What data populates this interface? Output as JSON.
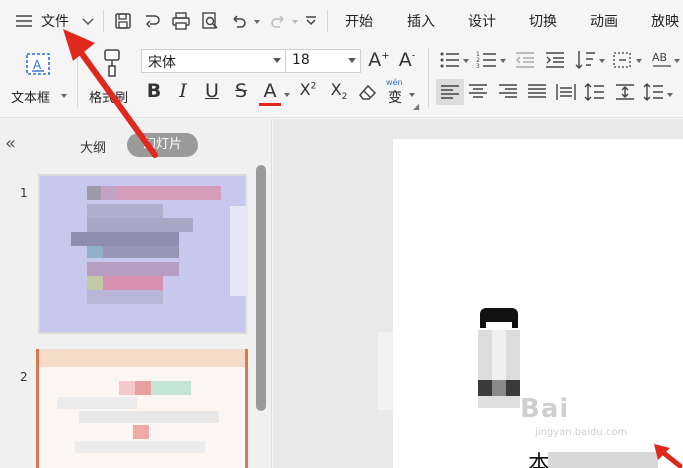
{
  "menubar": {
    "file_label": "文件",
    "tabs": [
      "开始",
      "插入",
      "设计",
      "切换",
      "动画",
      "放映"
    ]
  },
  "ribbon": {
    "textbox_label": "文本框",
    "format_painter_label": "格式刷",
    "font_name": "宋体",
    "font_size": "18",
    "phonetic_glyph": "wén",
    "phonetic_char": "变"
  },
  "left_panel": {
    "tab_outline": "大纲",
    "tab_slides": "幻灯片",
    "slide_numbers": [
      "1",
      "2"
    ]
  },
  "slide": {
    "visible_text": "本",
    "watermark": "Bai",
    "watermark_sub": "jingyan.baidu.com"
  },
  "colors": {
    "accent_red": "#e0281c",
    "font_color_underline": "#e0281c",
    "thumb_selected_border": "#d77a4f"
  },
  "icons": [
    "hamburger-icon",
    "chevron-down-icon",
    "save-icon",
    "export-icon",
    "print-icon",
    "print-preview-icon",
    "undo-icon",
    "redo-icon",
    "more-icon",
    "textbox-icon",
    "format-painter-icon"
  ]
}
